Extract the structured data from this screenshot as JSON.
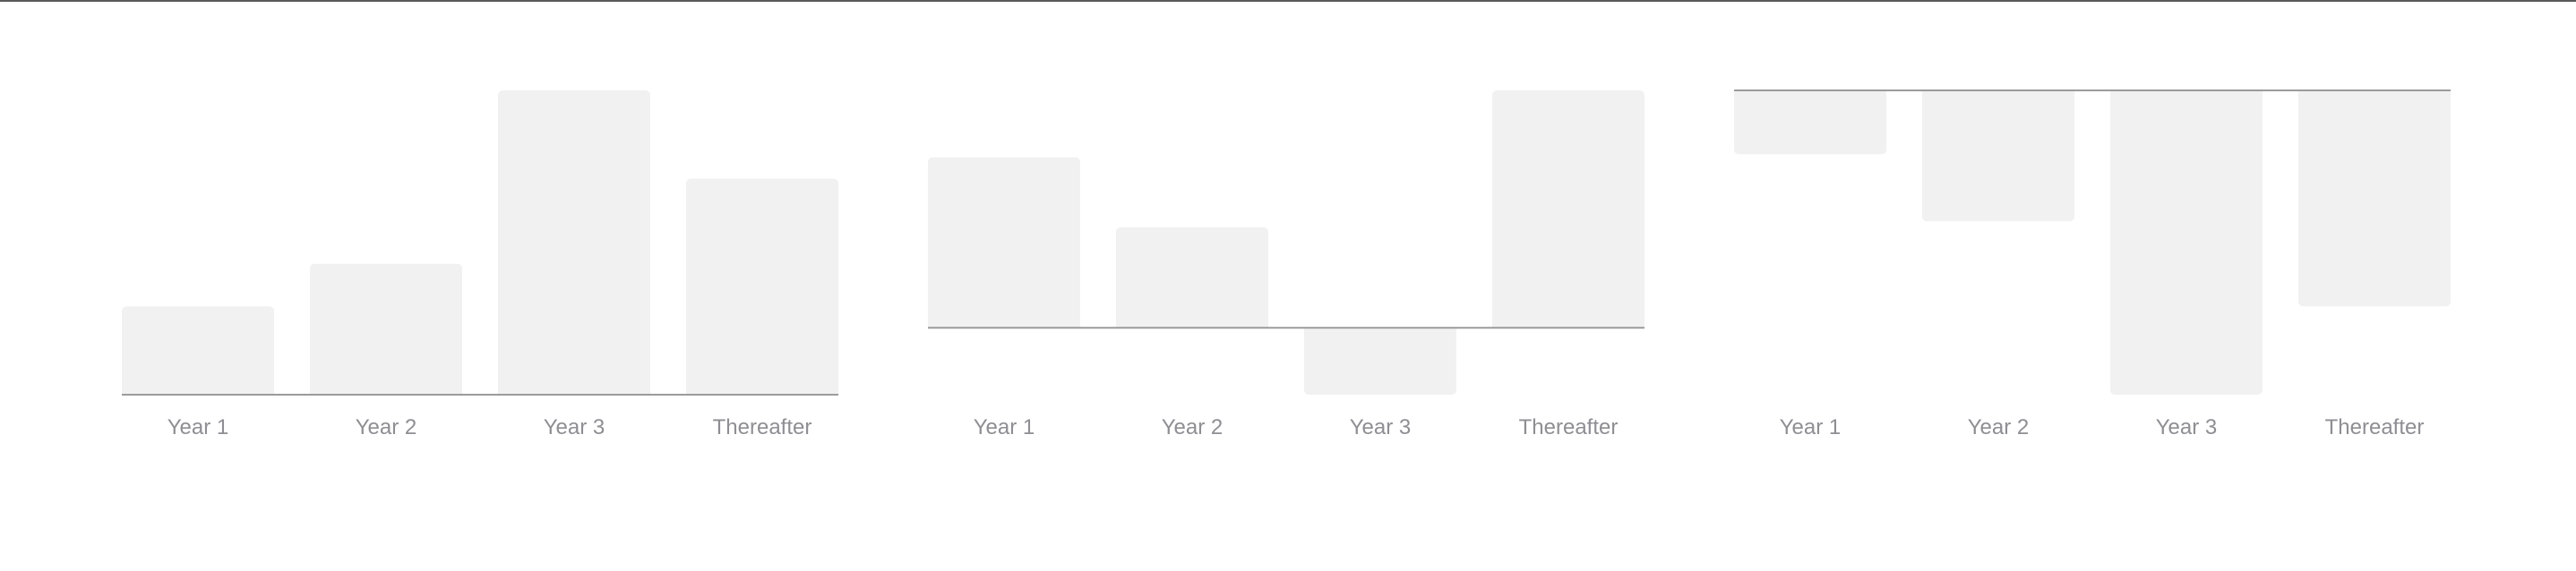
{
  "colors": {
    "bar_fill": "#f1f1f1",
    "baseline": "#9b9b9b",
    "label_text": "#8e8e93",
    "top_rule": "#5a5a5a"
  },
  "chart_data": [
    {
      "type": "bar",
      "categories": [
        "Year 1",
        "Year 2",
        "Year 3",
        "Thereafter"
      ],
      "values": [
        29,
        43,
        100,
        71
      ],
      "ylim": [
        0,
        100
      ],
      "grid": false,
      "legend": "none"
    },
    {
      "type": "bar",
      "categories": [
        "Year 1",
        "Year 2",
        "Year 3",
        "Thereafter"
      ],
      "values": [
        56,
        33,
        -22,
        78
      ],
      "ylim": [
        -22,
        78
      ],
      "grid": false,
      "legend": "none"
    },
    {
      "type": "bar",
      "categories": [
        "Year 1",
        "Year 2",
        "Year 3",
        "Thereafter"
      ],
      "values": [
        -21,
        -43,
        -100,
        -71
      ],
      "ylim": [
        -100,
        0
      ],
      "grid": false,
      "legend": "none"
    }
  ]
}
